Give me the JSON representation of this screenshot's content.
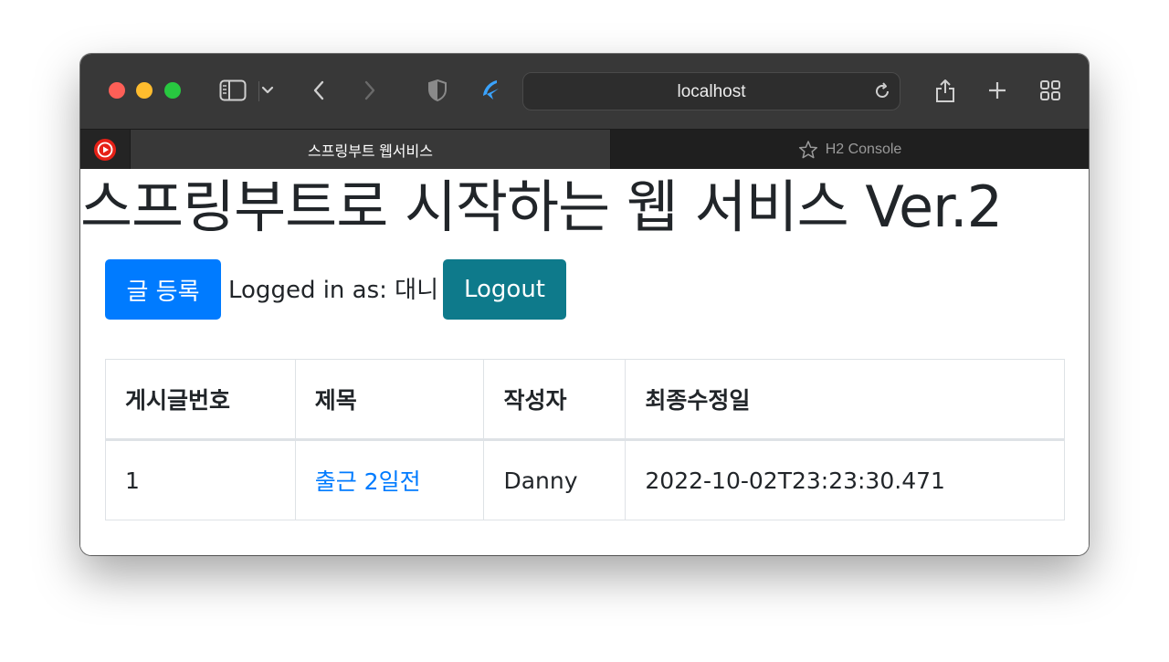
{
  "browser": {
    "address": "localhost",
    "tabs": [
      {
        "label": "스프링부트 웹서비스",
        "active": true
      },
      {
        "label": "H2 Console",
        "active": false
      }
    ],
    "colors": {
      "toolbar": "#383838",
      "tabbar": "#242424"
    }
  },
  "page": {
    "title": "스프링부트로 시작하는 웹 서비스 Ver.2",
    "register_button": "글 등록",
    "logged_in_text": "Logged in as: 대니",
    "logout_button": "Logout",
    "colors": {
      "primary": "#007bff",
      "info": "#0e7a8b",
      "text": "#212529"
    }
  },
  "table": {
    "headers": [
      "게시글번호",
      "제목",
      "작성자",
      "최종수정일"
    ],
    "rows": [
      {
        "id": "1",
        "title": "출근 2일전",
        "author": "Danny",
        "modified": "2022-10-02T23:23:30.471"
      }
    ]
  }
}
